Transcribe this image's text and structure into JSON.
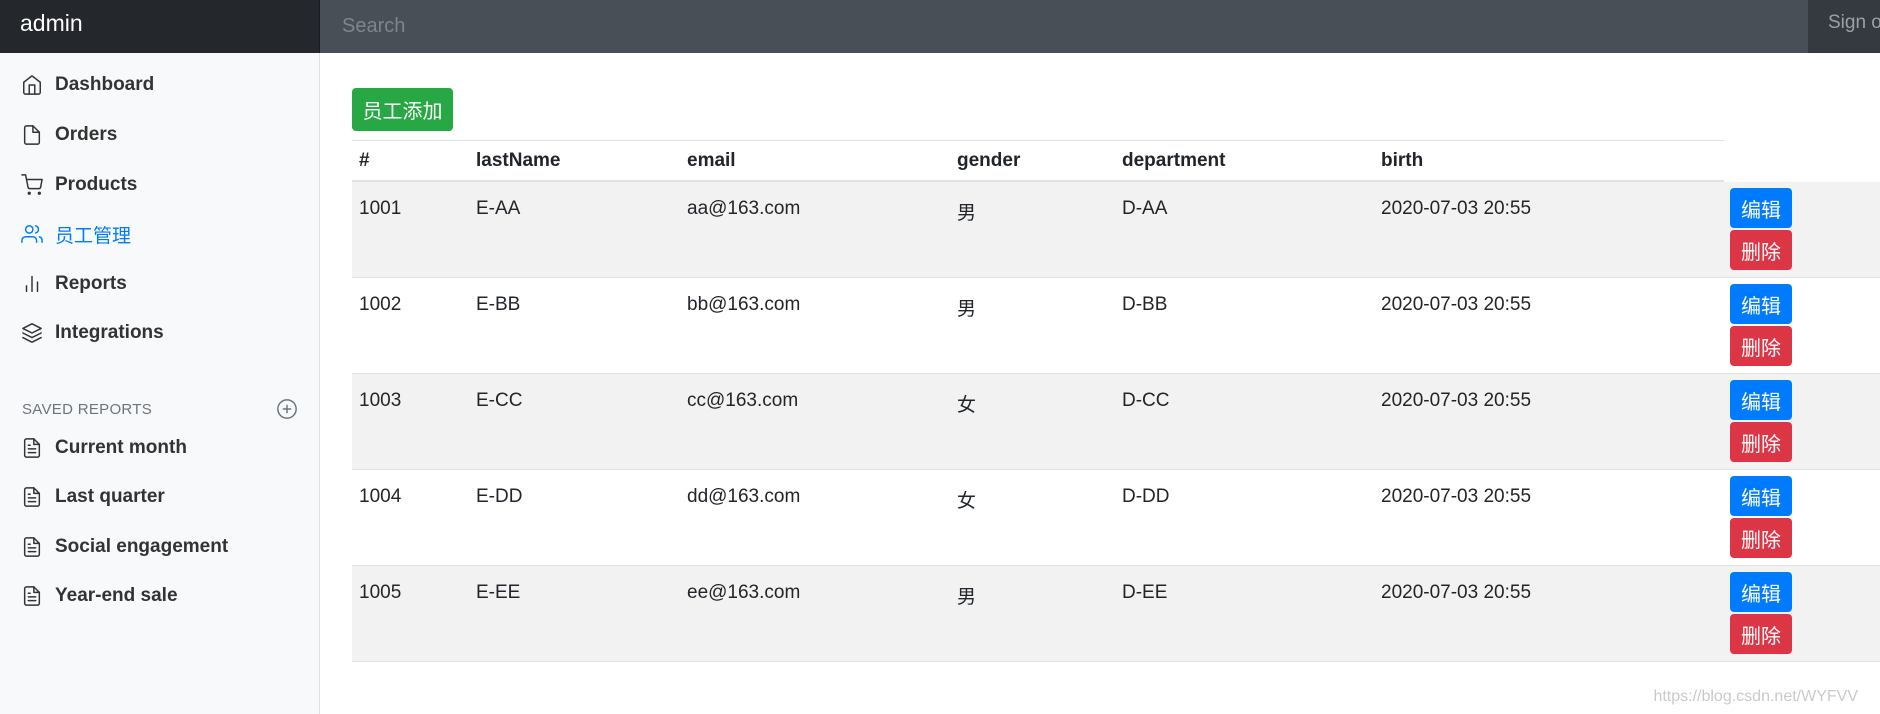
{
  "navbar": {
    "brand": "admin",
    "search_placeholder": "Search",
    "signout_label": "Sign out"
  },
  "sidebar": {
    "items": [
      {
        "label": "Dashboard",
        "icon": "home-icon"
      },
      {
        "label": "Orders",
        "icon": "file-icon"
      },
      {
        "label": "Products",
        "icon": "shopping-cart-icon"
      },
      {
        "label": "员工管理",
        "icon": "users-icon",
        "active": true
      },
      {
        "label": "Reports",
        "icon": "bar-chart-icon"
      },
      {
        "label": "Integrations",
        "icon": "layers-icon"
      }
    ],
    "saved_reports_heading": "SAVED REPORTS",
    "saved_reports": [
      {
        "label": "Current month",
        "icon": "file-text-icon"
      },
      {
        "label": "Last quarter",
        "icon": "file-text-icon"
      },
      {
        "label": "Social engagement",
        "icon": "file-text-icon"
      },
      {
        "label": "Year-end sale",
        "icon": "file-text-icon"
      }
    ]
  },
  "main": {
    "add_button_label": "员工添加",
    "table": {
      "headers": [
        "#",
        "lastName",
        "email",
        "gender",
        "department",
        "birth"
      ],
      "rows": [
        {
          "id": "1001",
          "lastName": "E-AA",
          "email": "aa@163.com",
          "gender": "男",
          "department": "D-AA",
          "birth": "2020-07-03 20:55"
        },
        {
          "id": "1002",
          "lastName": "E-BB",
          "email": "bb@163.com",
          "gender": "男",
          "department": "D-BB",
          "birth": "2020-07-03 20:55"
        },
        {
          "id": "1003",
          "lastName": "E-CC",
          "email": "cc@163.com",
          "gender": "女",
          "department": "D-CC",
          "birth": "2020-07-03 20:55"
        },
        {
          "id": "1004",
          "lastName": "E-DD",
          "email": "dd@163.com",
          "gender": "女",
          "department": "D-DD",
          "birth": "2020-07-03 20:55"
        },
        {
          "id": "1005",
          "lastName": "E-EE",
          "email": "ee@163.com",
          "gender": "男",
          "department": "D-EE",
          "birth": "2020-07-03 20:55"
        }
      ],
      "edit_label": "编辑",
      "delete_label": "删除"
    }
  },
  "watermark": "https://blog.csdn.net/WYFVV",
  "colors": {
    "navbar_bg": "#343a40",
    "brand_bg": "#24282c",
    "sidebar_bg": "#f8f9fa",
    "active_link": "#007bff",
    "add_button": "#28a745",
    "edit_button": "#007bff",
    "delete_button": "#dc3545",
    "stripe": "#f2f2f2"
  }
}
